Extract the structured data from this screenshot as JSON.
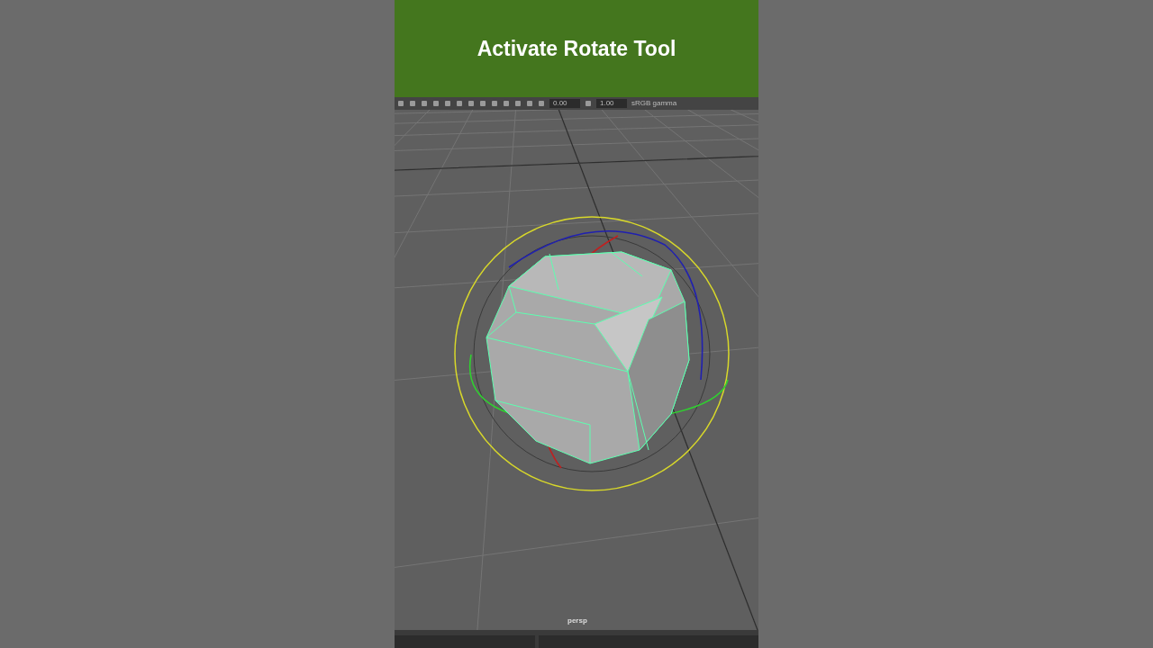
{
  "banner": {
    "title": "Activate Rotate Tool"
  },
  "toolbar": {
    "fields": [
      "0.00",
      "1.00"
    ],
    "color_space": "sRGB gamma"
  },
  "viewport": {
    "camera": "persp"
  }
}
